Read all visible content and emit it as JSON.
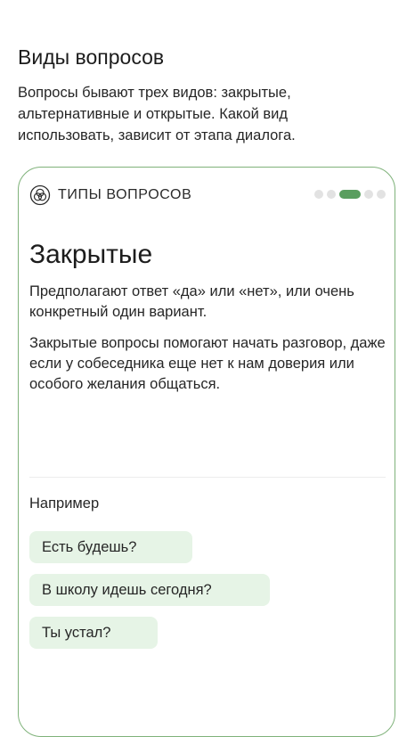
{
  "section": {
    "title": "Виды вопросов",
    "description": "Вопросы бывают трех видов: закрытые, альтернативные и открытые. Какой вид использовать, зависит от этапа диалога."
  },
  "card": {
    "label": "ТИПЫ ВОПРОСОВ",
    "icon": "venn-circles-icon",
    "progress": {
      "total": 5,
      "current": 3
    },
    "title": "Закрытые",
    "paragraph1": "Предполагают ответ «да» или «нет», или очень конкретный один вариант.",
    "paragraph2": "Закрытые вопросы помогают начать разговор, даже если  у собеседника еще нет к нам доверия или особого желания общаться.",
    "examples_label": "Например",
    "examples": [
      "Есть будешь?",
      "В школу идешь сегодня?",
      "Ты устал?"
    ]
  },
  "colors": {
    "accent": "#5a9e5f",
    "card_border": "#7fb27a",
    "chip_background": "#e6f4e6",
    "dot_inactive": "#e2e2e2"
  }
}
